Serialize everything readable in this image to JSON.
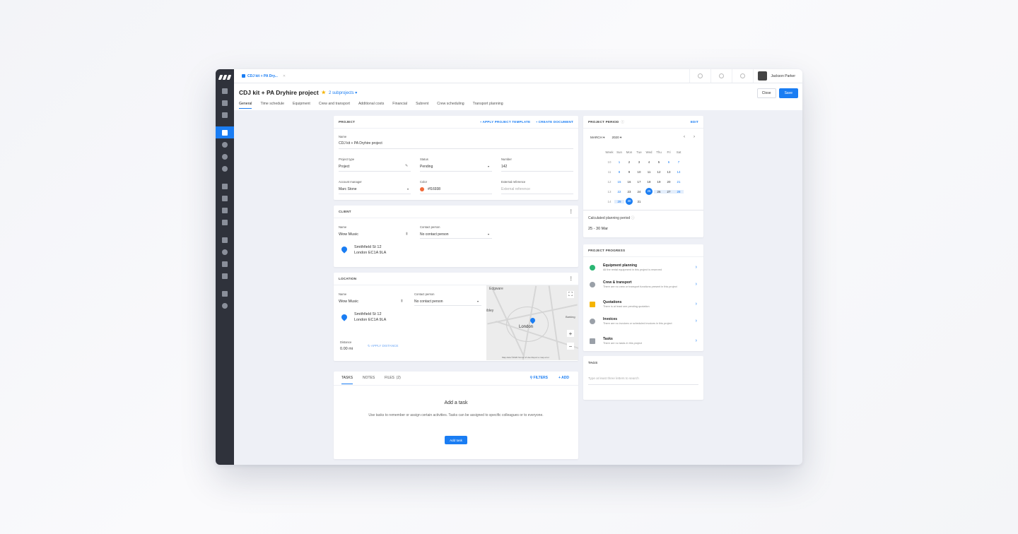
{
  "topbar": {
    "tab_label": "CDJ kit + PA Dry...",
    "user_name": "Jackson Parker"
  },
  "header": {
    "title": "CDJ kit + PA Dryhire project",
    "subprojects": "2 subprojects",
    "close": "Close",
    "save": "Save"
  },
  "tabs": [
    "General",
    "Time schedule",
    "Equipment",
    "Crew and transport",
    "Additional costs",
    "Financial",
    "Subrent",
    "Crew scheduling",
    "Transport planning"
  ],
  "project": {
    "heading": "PROJECT",
    "apply_template": "APPLY PROJECT TEMPLATE",
    "create_document": "CREATE DOCUMENT",
    "name_label": "Name",
    "name": "CDJ kit + PA Dryhire project",
    "type_label": "Project type",
    "type": "Project",
    "status_label": "Status",
    "status": "Pending",
    "number_label": "Number",
    "number": "142",
    "manager_label": "Account manager",
    "manager": "Marc Stone",
    "color_label": "Color",
    "color": "#f16938",
    "ref_label": "External reference",
    "ref_placeholder": "External reference"
  },
  "client": {
    "heading": "CLIENT",
    "name_label": "Name",
    "name": "Wow Music",
    "contact_label": "Contact person",
    "contact": "No contact person",
    "addr1": "Smithfield St 12",
    "addr2": "London  EC1A 9LA"
  },
  "location": {
    "heading": "LOCATION",
    "name_label": "Name",
    "name": "Wow Music",
    "contact_label": "Contact person",
    "contact": "No contact person",
    "addr1": "Smithfield St 12",
    "addr2": "London  EC1A 9LA",
    "distance_label": "Distance",
    "distance": "0.00 mi",
    "apply_distance": "APPLY DISTANCE",
    "map_city": "London",
    "map_edgware": "Edgware",
    "map_ibley": "ibley",
    "map_barking": "Barking",
    "map_footer": "Map data ©2020   Terms of Use   Report a map error"
  },
  "tasks": {
    "tab_tasks": "TASKS",
    "tab_notes": "NOTES",
    "tab_files": "FILES  (2)",
    "filters": "FILTERS",
    "add": "+ ADD",
    "empty_title": "Add a task",
    "empty_text": "Use tasks to remember or assign certain activities. Tasks can be assigned to specific colleagues or to everyone.",
    "add_task": "Add task"
  },
  "period": {
    "heading": "PROJECT PERIOD",
    "edit": "EDIT",
    "month": "MARCH",
    "year": "2020",
    "days": [
      "Week",
      "Sun",
      "Mon",
      "Tue",
      "Wed",
      "Thu",
      "Fri",
      "Sat"
    ],
    "weeks": [
      [
        "10",
        "1",
        "2",
        "3",
        "4",
        "5",
        "6",
        "7"
      ],
      [
        "11",
        "8",
        "9",
        "10",
        "11",
        "12",
        "13",
        "14"
      ],
      [
        "12",
        "15",
        "16",
        "17",
        "18",
        "19",
        "20",
        "21"
      ],
      [
        "13",
        "22",
        "23",
        "24",
        "25",
        "26",
        "27",
        "28"
      ],
      [
        "14",
        "29",
        "30",
        "31",
        "",
        "",
        "",
        ""
      ]
    ],
    "calc_label": "Calculated planning period",
    "calc_value": "25 - 30 Mar"
  },
  "progress": {
    "heading": "PROJECT PROGRESS",
    "items": [
      {
        "title": "Equipment planning",
        "desc": "All the rental equipment in this project is reserved",
        "color": "#2bb673"
      },
      {
        "title": "Crew & transport",
        "desc": "There are no crew or transport functions present in this project",
        "color": "#9aa0a8"
      },
      {
        "title": "Quotations",
        "desc": "There is at least one pending quotation",
        "color": "#f5b400"
      },
      {
        "title": "Invoices",
        "desc": "There are no invoices or scheduled invoices in this project",
        "color": "#9aa0a8"
      },
      {
        "title": "Tasks",
        "desc": "There are no tasks in this project",
        "color": "#9aa0a8"
      }
    ]
  },
  "tags": {
    "heading": "TAGS",
    "placeholder": "Type at least three letters to search"
  }
}
